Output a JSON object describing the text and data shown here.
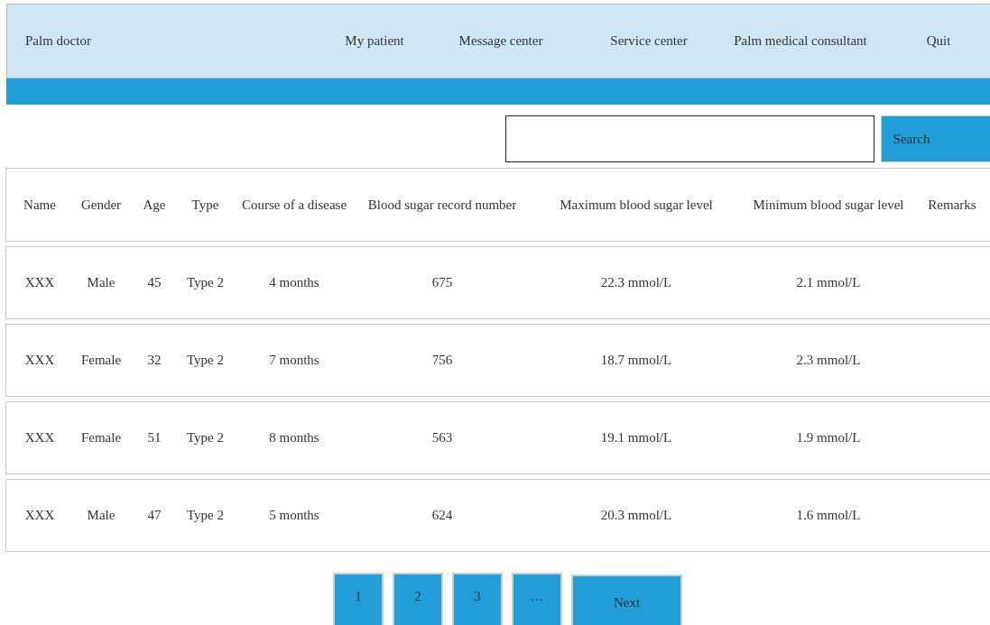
{
  "header": {
    "title": "Palm doctor",
    "nav": [
      "My patient",
      "Message center",
      "Service center",
      "Palm medical consultant",
      "Quit"
    ]
  },
  "search": {
    "button": "Search"
  },
  "table": {
    "columns": [
      "Name",
      "Gender",
      "Age",
      "Type",
      "Course of a disease",
      "Blood sugar record number",
      "Maximum blood sugar level",
      "Minimum blood sugar level",
      "Remarks"
    ],
    "rows": [
      [
        "XXX",
        "Male",
        "45",
        "Type 2",
        "4 months",
        "675",
        "22.3 mmol/L",
        "2.1 mmol/L"
      ],
      [
        "XXX",
        "Female",
        "32",
        "Type 2",
        "7 months",
        "756",
        "18.7 mmol/L",
        "2.3 mmol/L"
      ],
      [
        "XXX",
        "Female",
        "51",
        "Type 2",
        "8 months",
        "563",
        "19.1 mmol/L",
        "1.9 mmol/L"
      ],
      [
        "XXX",
        "Male",
        "47",
        "Type 2",
        "5 months",
        "624",
        "20.3 mmol/L",
        "1.6 mmol/L"
      ]
    ]
  },
  "pagination": [
    "1",
    "2",
    "3",
    "…",
    "Next"
  ]
}
